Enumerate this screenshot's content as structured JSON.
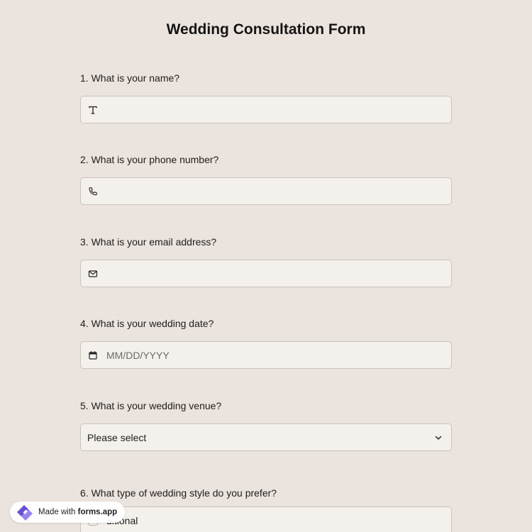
{
  "form": {
    "title": "Wedding Consultation Form",
    "questions": [
      {
        "label": "1.  What is your name?",
        "icon": "text-icon",
        "value": "",
        "placeholder": ""
      },
      {
        "label": "2. What is your phone number?",
        "icon": "phone-icon",
        "value": "",
        "placeholder": ""
      },
      {
        "label": "3. What is your email address?",
        "icon": "mail-icon",
        "value": "",
        "placeholder": ""
      },
      {
        "label": "4. What is your wedding date?",
        "icon": "calendar-icon",
        "value": "",
        "placeholder": "MM/DD/YYYY"
      },
      {
        "label": "5. What is your wedding venue?",
        "icon": "chevron-down-icon",
        "selected": "Please select"
      },
      {
        "label": "6. What type of wedding style do you prefer?",
        "option_visible": "ditional"
      }
    ]
  },
  "badge": {
    "prefix": "Made with ",
    "brand": "forms.app",
    "logo_colors": [
      "#6b4fd8",
      "#9b83f0"
    ]
  },
  "colors": {
    "background": "#ebe3dd",
    "field_bg": "#f4f1ec",
    "field_border": "#c9c2bc"
  }
}
